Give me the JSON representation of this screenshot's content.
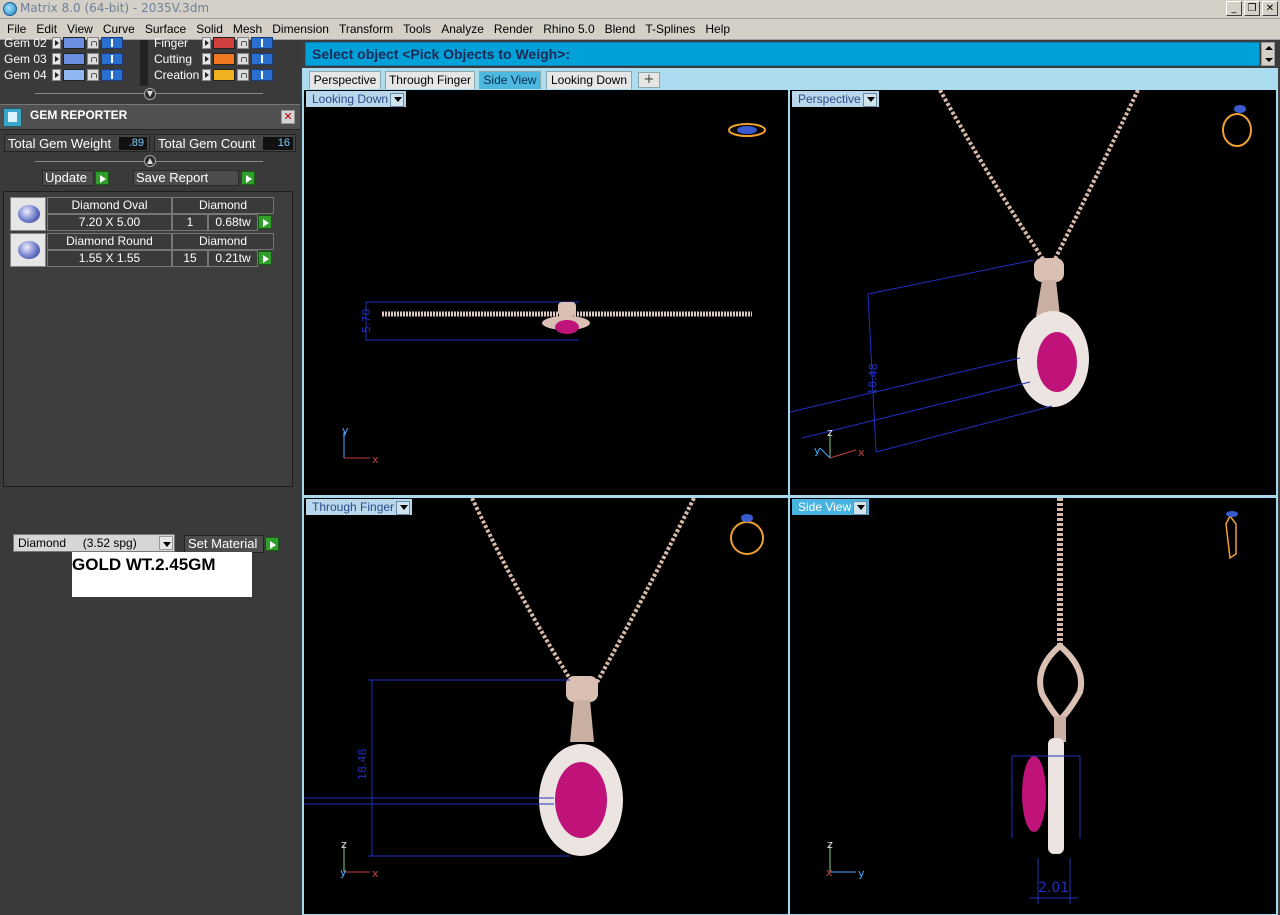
{
  "window": {
    "title": "Matrix 8.0 (64-bit) - 2035V.3dm",
    "controls": [
      "minimize",
      "restore",
      "close"
    ]
  },
  "menu": [
    "File",
    "Edit",
    "View",
    "Curve",
    "Surface",
    "Solid",
    "Mesh",
    "Dimension",
    "Transform",
    "Tools",
    "Analyze",
    "Render",
    "Rhino 5.0",
    "Blend",
    "T-Splines",
    "Help"
  ],
  "layers": {
    "left": [
      {
        "name": "Gem 02",
        "color": "#6b8fe0"
      },
      {
        "name": "Gem 03",
        "color": "#6b8fe0"
      },
      {
        "name": "Gem 04",
        "color": "#8fb8f0"
      }
    ],
    "right": [
      {
        "name": "Finger",
        "color": "#d04040"
      },
      {
        "name": "Cutting",
        "color": "#f07820"
      },
      {
        "name": "Creation",
        "color": "#f0b020"
      }
    ]
  },
  "gem_reporter": {
    "title": "GEM REPORTER",
    "total_weight_label": "Total Gem Weight",
    "total_weight_value": ".89",
    "total_count_label": "Total Gem Count",
    "total_count_value": "16",
    "update_label": "Update",
    "save_label": "Save Report",
    "gems": [
      {
        "shape": "Diamond Oval",
        "size": "7.20 X 5.00",
        "material": "Diamond",
        "count": "1",
        "weight": "0.68tw"
      },
      {
        "shape": "Diamond Round",
        "size": "1.55 X 1.55",
        "material": "Diamond",
        "count": "15",
        "weight": "0.21tw"
      }
    ],
    "material_select": "Diamond     (3.52 spg)",
    "set_material_label": "Set Material"
  },
  "note": "GOLD WT.2.45GM",
  "command_prompt": "Select object <Pick Objects to Weigh>:",
  "view_tabs": [
    {
      "label": "Perspective",
      "active": false
    },
    {
      "label": "Through Finger",
      "active": false
    },
    {
      "label": "Side View",
      "active": true
    },
    {
      "label": "Looking Down",
      "active": false
    }
  ],
  "add_tab_symbol": "+",
  "viewports": {
    "top_left": {
      "label": "Looking Down",
      "dimension": "5.70"
    },
    "top_right": {
      "label": "Perspective",
      "dimension": "18.48"
    },
    "bottom_left": {
      "label": "Through Finger",
      "dimension": "18.48"
    },
    "bottom_right": {
      "label": "Side View",
      "dimension": "2.01"
    }
  },
  "axis_labels": {
    "x": "x",
    "y": "y",
    "z": "z"
  },
  "colors": {
    "command_bar": "#00a0d8",
    "active_tab": "#4cb8e0",
    "viewport_bg": "#000000",
    "ruby": "#c0137a",
    "chain": "#d8b8a8",
    "dimension_line": "#1b2ad0"
  }
}
